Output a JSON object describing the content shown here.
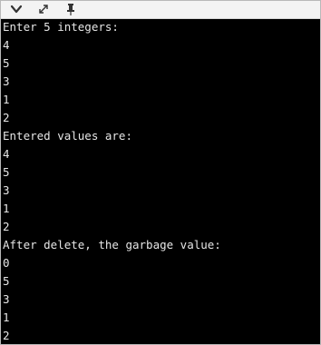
{
  "toolbar": {
    "icons": [
      "chevron-down-icon",
      "expand-icon",
      "pin-icon"
    ]
  },
  "console": {
    "lines": [
      "Enter 5 integers:",
      "4",
      "5",
      "3",
      "1",
      "2",
      "Entered values are:",
      "4",
      "5",
      "3",
      "1",
      "2",
      "After delete, the garbage value:",
      "0",
      "5",
      "3",
      "1",
      "2"
    ]
  }
}
